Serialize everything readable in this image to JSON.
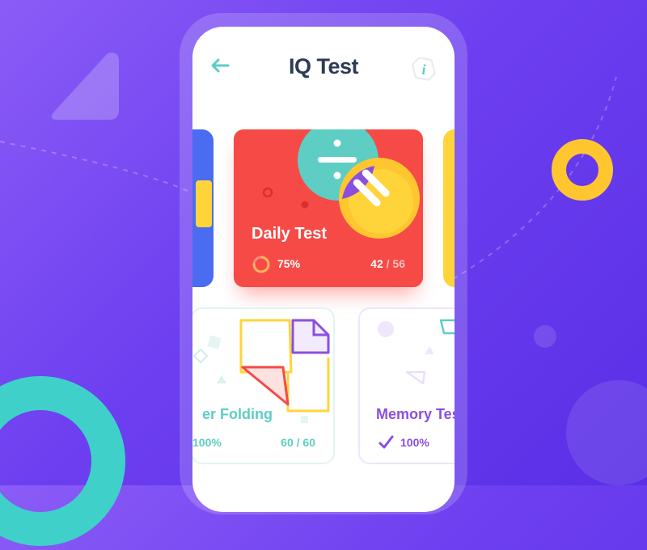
{
  "header": {
    "title": "IQ Test",
    "back_icon": "arrow-left-icon",
    "info_icon": "info-icon",
    "info_label": "i"
  },
  "featured_card": {
    "title": "Daily Test",
    "percent": "75%",
    "progress": 0.75,
    "score": "42",
    "total": "/ 56",
    "color": "#f64a46"
  },
  "cards": [
    {
      "title": "Paper Folding",
      "visible_title": "er Folding",
      "percent": "100%",
      "score": "60 / 60",
      "color": "#5ecdc4"
    },
    {
      "title": "Memory Test",
      "visible_title": "Memory Tes",
      "percent": "100%",
      "color": "#8a4fe0"
    }
  ],
  "colors": {
    "background": "#6d3ff0",
    "teal": "#5ecdc4",
    "yellow": "#ffc62f",
    "purple": "#8a4fe0",
    "blue": "#4a6cf0"
  }
}
